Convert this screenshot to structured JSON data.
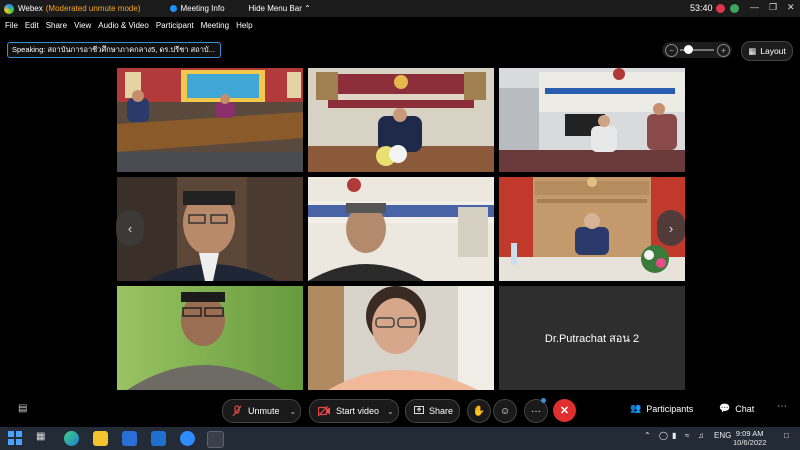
{
  "titlebar": {
    "app_name": "Webex",
    "mode": "(Moderated unmute mode)",
    "meeting_info": "Meeting Info",
    "hide_menu": "Hide Menu Bar",
    "timer": "53:40"
  },
  "menu": [
    "File",
    "Edit",
    "Share",
    "View",
    "Audio & Video",
    "Participant",
    "Meeting",
    "Help"
  ],
  "speaking": "Speaking: สถาบันการอาชีวศึกษาภาคกลาง5, ดร.ปรีชา สถาบั...",
  "layout_label": "Layout",
  "tiles": [
    {
      "name": "video-tile-conference-room"
    },
    {
      "name": "video-tile-presenter-stage"
    },
    {
      "name": "video-tile-office-two-people"
    },
    {
      "name": "video-tile-man-glasses"
    },
    {
      "name": "video-tile-man-sign"
    },
    {
      "name": "video-tile-woman-red-room"
    },
    {
      "name": "video-tile-man-green"
    },
    {
      "name": "video-tile-woman-glasses"
    },
    {
      "name": "Dr.Putrachat สอน 2"
    }
  ],
  "controls": {
    "unmute": "Unmute",
    "start_video": "Start video",
    "share": "Share",
    "participants": "Participants",
    "chat": "Chat",
    "more": "···"
  },
  "taskbar": {
    "lang": "ENG",
    "time": "9:09 AM",
    "date": "10/6/2022"
  },
  "colors": {
    "accent_blue": "#1e90ff",
    "end_red": "#e02f2f",
    "mode_orange": "#f5a623",
    "taskbar": "#232b36"
  }
}
